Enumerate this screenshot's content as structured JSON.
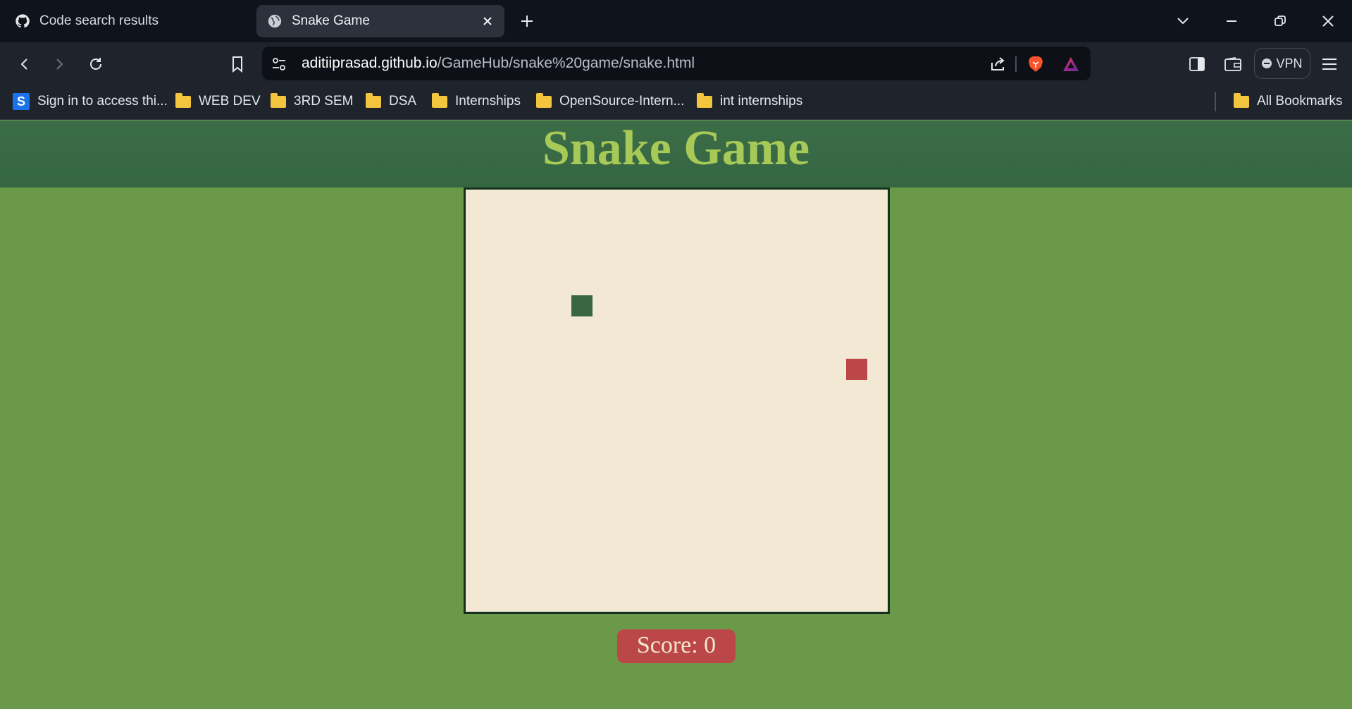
{
  "browser": {
    "tabs": [
      {
        "title": "Code search results",
        "icon": "github-icon",
        "active": false
      },
      {
        "title": "Snake Game",
        "icon": "globe-icon",
        "active": true
      }
    ],
    "address_bar": {
      "host": "aditiiprasad.github.io",
      "path": "/GameHub/snake%20game/snake.html"
    },
    "vpn_label": "VPN",
    "bookmarks": [
      {
        "label": "Sign in to access thi...",
        "icon": "s-app-icon"
      },
      {
        "label": "WEB DEV",
        "icon": "folder-icon"
      },
      {
        "label": "3RD SEM",
        "icon": "folder-icon"
      },
      {
        "label": "DSA",
        "icon": "folder-icon"
      },
      {
        "label": "Internships",
        "icon": "folder-icon"
      },
      {
        "label": "OpenSource-Intern...",
        "icon": "folder-icon"
      },
      {
        "label": "int internships",
        "icon": "folder-icon"
      }
    ],
    "all_bookmarks_label": "All Bookmarks"
  },
  "page": {
    "title": "Snake Game",
    "score_text": "Score: 0"
  },
  "game": {
    "snake": [
      {
        "col": 5,
        "row": 5
      }
    ],
    "food": {
      "col": 18,
      "row": 8
    }
  },
  "colors": {
    "page_background": "#6a994a",
    "header_background": "#386641",
    "title_color": "#a7c957",
    "board_background": "#f2e8d4",
    "snake_color": "#386641",
    "food_color": "#bc4749",
    "score_background": "#bc4749"
  }
}
